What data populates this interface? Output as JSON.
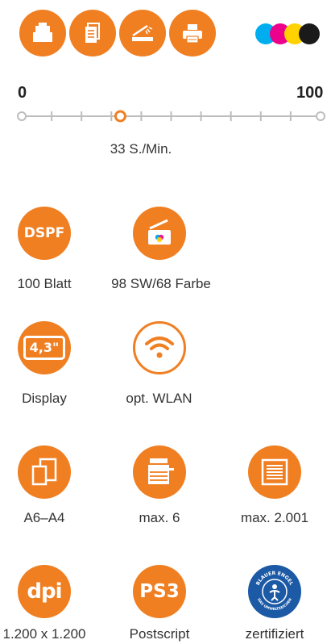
{
  "header": {
    "function_icons": [
      "copy-icon",
      "document-icon",
      "scanner-icon",
      "printer-icon"
    ],
    "ink_colors": [
      "#00AEEF",
      "#EC008C",
      "#FFD200",
      "#1A1A1A"
    ]
  },
  "speed_scale": {
    "min_label": "0",
    "max_label": "100",
    "value": 33,
    "value_label": "33 S./Min."
  },
  "features": {
    "dspf": {
      "badge": "DSPF",
      "label": "100 Blatt"
    },
    "color_scan": {
      "icon": "color-scanner-icon",
      "label": "98 SW/68 Farbe"
    },
    "display": {
      "badge": "4,3\"",
      "label": "Display"
    },
    "wlan": {
      "icon": "wifi-icon",
      "label": "opt. WLAN"
    },
    "paper_size": {
      "icon": "paper-size-icon",
      "label": "A6–A4"
    },
    "trays": {
      "icon": "copier-icon",
      "label": "max. 6"
    },
    "capacity": {
      "icon": "paper-stack-icon",
      "label": "max. 2.001"
    },
    "resolution": {
      "badge": "dpi",
      "label": "1.200 x 1.200"
    },
    "postscript": {
      "badge": "PS3",
      "label": "Postscript"
    },
    "eco": {
      "seal_top": "BLAUER ENGEL",
      "seal_bottom": "DAS UMWELTZEICHEN",
      "label": "zertifiziert"
    }
  },
  "colors": {
    "accent": "#F07F22",
    "line": "#BDBDBD",
    "eco_blue": "#1C5AA6"
  }
}
